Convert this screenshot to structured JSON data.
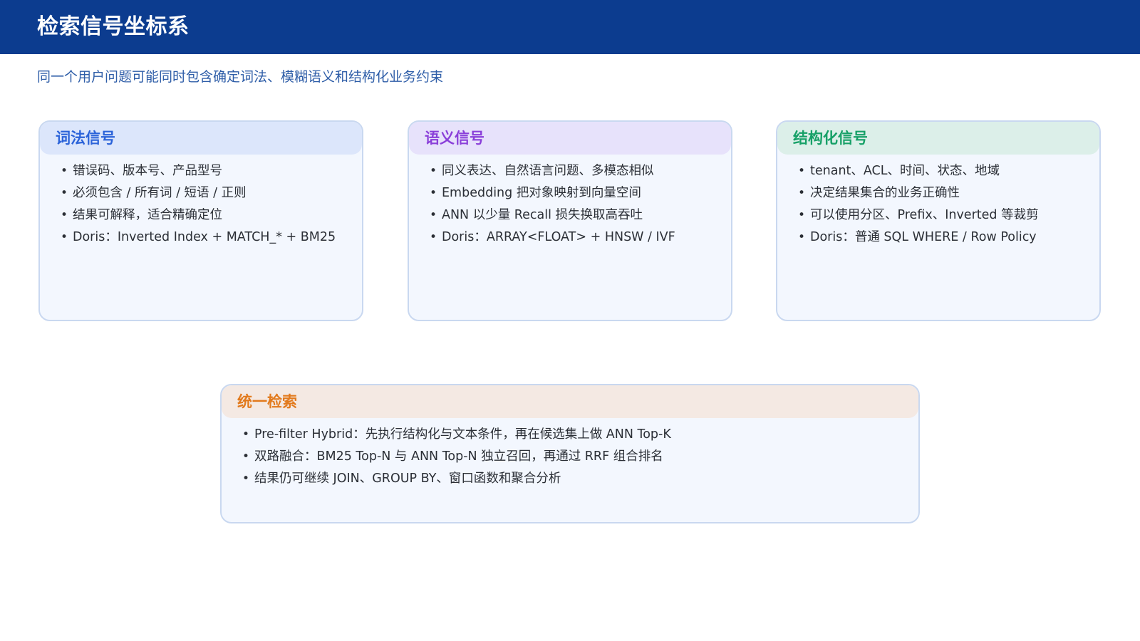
{
  "header": {
    "title": "检索信号坐标系"
  },
  "subtitle": "同一个用户问题可能同时包含确定词法、模糊语义和结构化业务约束",
  "colors": {
    "header_bg": "#0c3c8f",
    "lexical_accent": "#2b63d9",
    "semantic_accent": "#8a3fd9",
    "structured_accent": "#16a067",
    "unified_accent": "#e27a1d"
  },
  "cards": {
    "lexical": {
      "title": "词法信号",
      "items": [
        "错误码、版本号、产品型号",
        "必须包含 / 所有词 / 短语 / 正则",
        "结果可解释，适合精确定位",
        "Doris：Inverted Index + MATCH_* + BM25"
      ]
    },
    "semantic": {
      "title": "语义信号",
      "items": [
        "同义表达、自然语言问题、多模态相似",
        "Embedding 把对象映射到向量空间",
        "ANN 以少量 Recall 损失换取高吞吐",
        "Doris：ARRAY<FLOAT> + HNSW / IVF"
      ]
    },
    "structured": {
      "title": "结构化信号",
      "items": [
        "tenant、ACL、时间、状态、地域",
        "决定结果集合的业务正确性",
        "可以使用分区、Prefix、Inverted 等裁剪",
        "Doris：普通 SQL WHERE / Row Policy"
      ]
    },
    "unified": {
      "title": "统一检索",
      "items": [
        "Pre-filter Hybrid：先执行结构化与文本条件，再在候选集上做 ANN Top-K",
        "双路融合：BM25 Top-N 与 ANN Top-N 独立召回，再通过 RRF 组合排名",
        "结果仍可继续 JOIN、GROUP BY、窗口函数和聚合分析"
      ]
    }
  },
  "bullet_glyph": "•"
}
